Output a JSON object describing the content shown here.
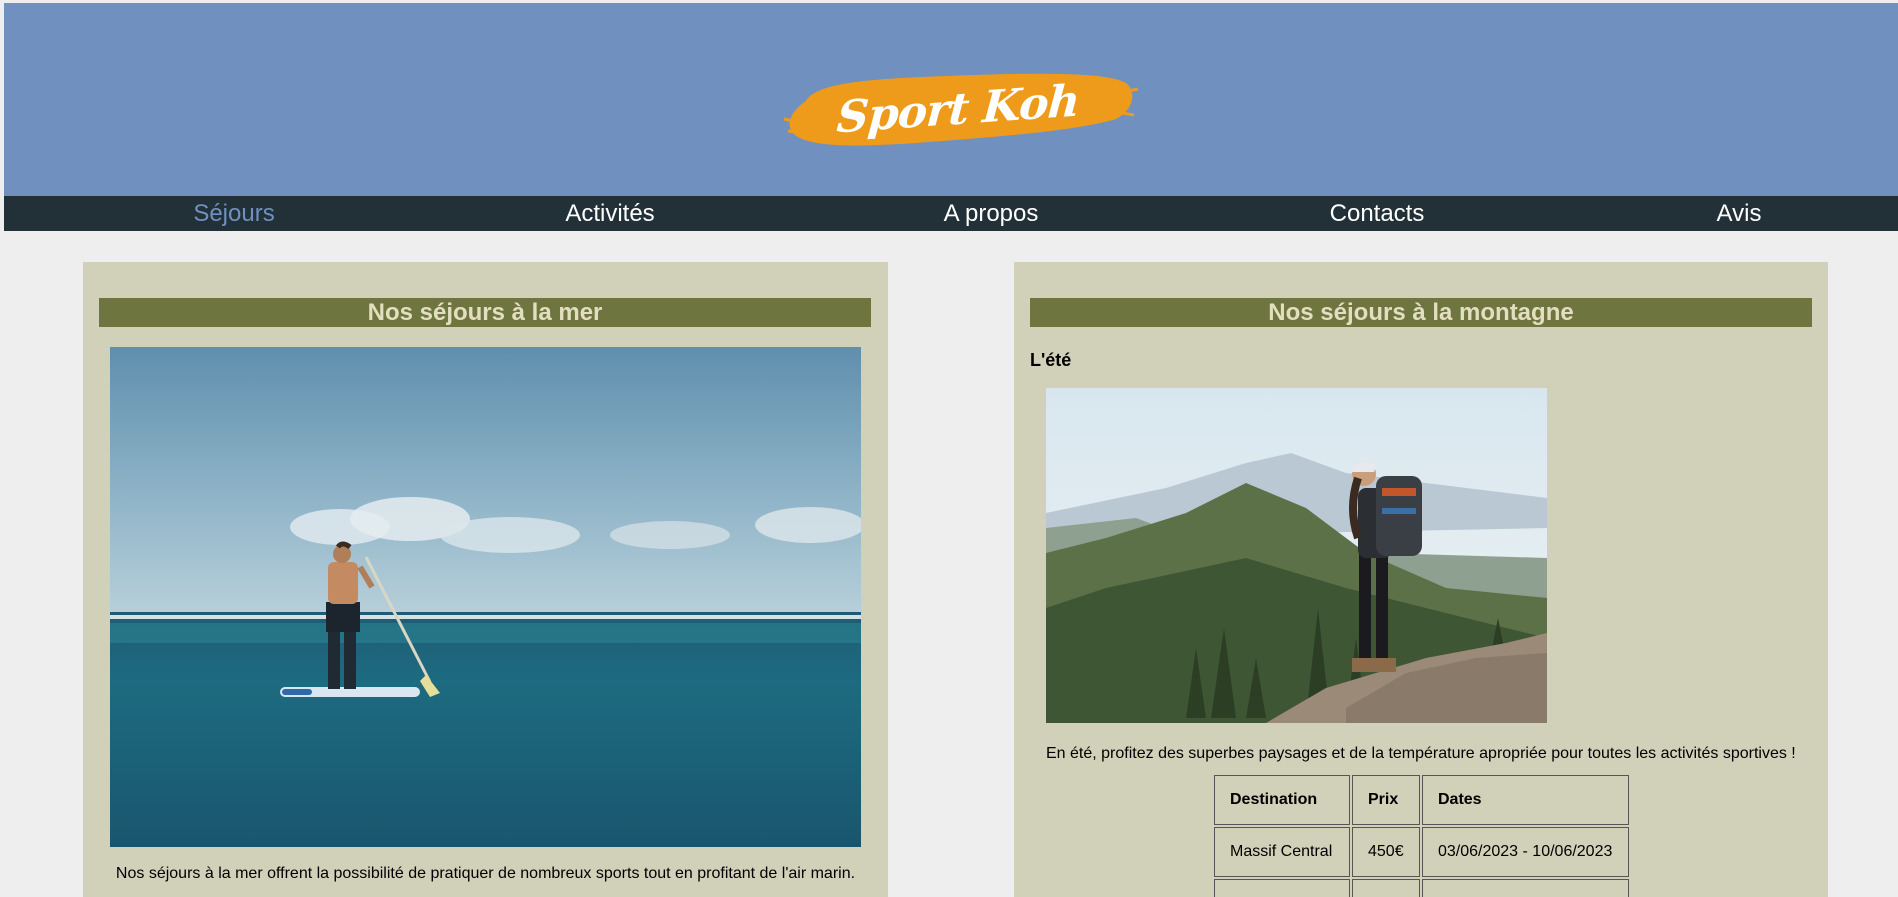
{
  "brand": {
    "name": "Sport Koh",
    "header_color": "#7090bf",
    "logo_color": "#ee9b1c"
  },
  "nav": {
    "items": [
      {
        "label": "Séjours",
        "active": true
      },
      {
        "label": "Activités",
        "active": false
      },
      {
        "label": "A propos",
        "active": false
      },
      {
        "label": "Contacts",
        "active": false
      },
      {
        "label": "Avis",
        "active": false
      }
    ]
  },
  "sea": {
    "title": "Nos séjours à la mer",
    "description": "Nos séjours à la mer offrent la possibilité de pratiquer de nombreux sports tout en profitant de l'air marin."
  },
  "mountain": {
    "title": "Nos séjours à la montagne",
    "season": "L'été",
    "description": "En été, profitez des superbes paysages et de la température apropriée pour toutes les activités sportives !",
    "table": {
      "headers": [
        "Destination",
        "Prix",
        "Dates"
      ],
      "rows": [
        [
          "Massif Central",
          "450€",
          "03/06/2023 - 10/06/2023"
        ],
        [
          "",
          "",
          ""
        ]
      ]
    }
  }
}
